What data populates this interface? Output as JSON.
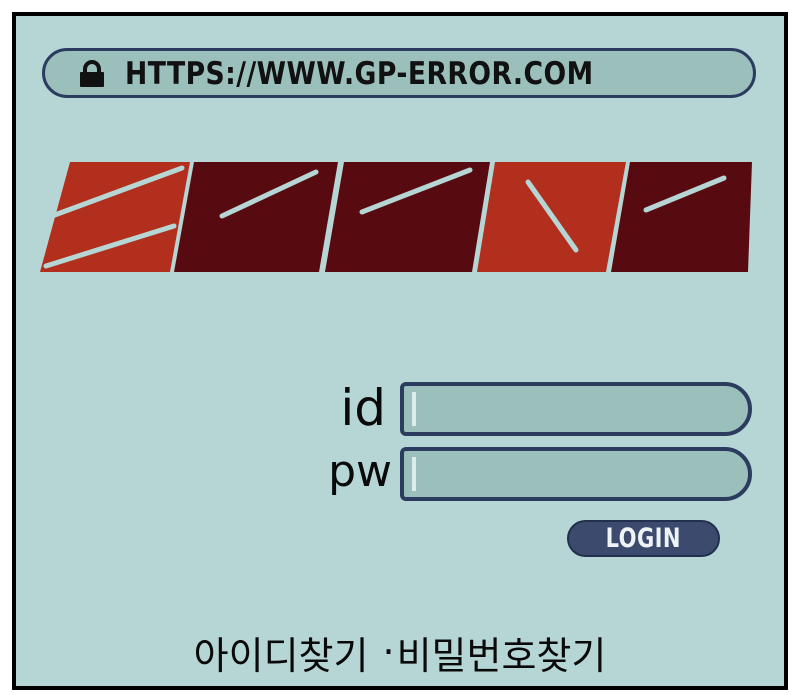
{
  "url_bar": {
    "icon": "lock-icon",
    "url": "HTTPS://WWW.GP-ERROR.COM"
  },
  "logo": {
    "text": "ERROR"
  },
  "login_form": {
    "id_label": "id",
    "pw_label": "pw",
    "login_button_label": "LOGIN"
  },
  "footer": {
    "find_id_link": "아이디찾기",
    "separator": "·",
    "find_pw_link": "비밀번호찾기"
  },
  "colors": {
    "background": "#b5d6d4",
    "field": "#9bbfbb",
    "border": "#2c3c5f",
    "button": "#3b4a6d",
    "logo-red": "#b22f1d",
    "logo-dark": "#570b10",
    "logo-line": "#b5d6d4",
    "caret": "#dcecea"
  }
}
